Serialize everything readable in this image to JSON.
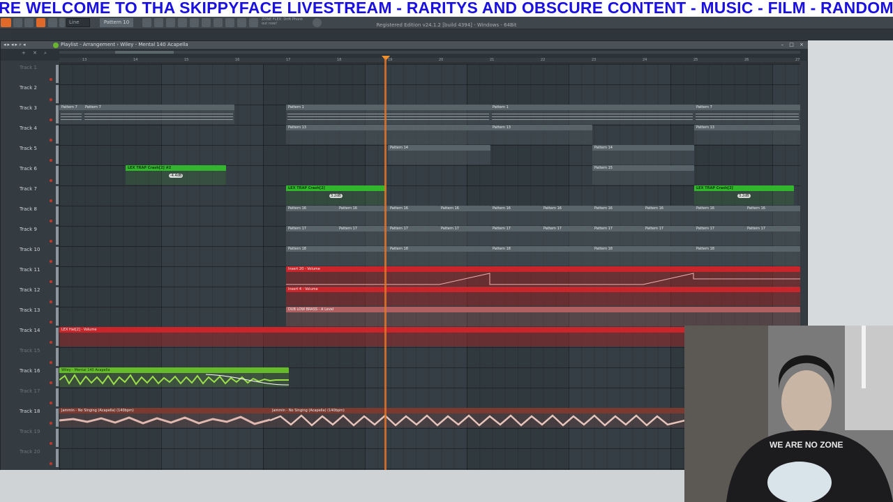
{
  "banner": {
    "text": "RE  WELCOME TO THA SKIPPYFACE LIVESTREAM  - RARITYS AND OBSCURE CONTENT - MUSIC - FILM - RANDOM - GTARP / C"
  },
  "toolbar": {
    "snap": "Line",
    "pattern": "Pattern 10",
    "hint_line1": "ZONE FLEX: Drift Phonk",
    "hint_line2": "out now!"
  },
  "playlist": {
    "title": "Playlist - Arrangement › Wiley - Mental 140 Acapella",
    "controls": "– □ ×"
  },
  "ruler": [
    "13",
    "14",
    "15",
    "16",
    "17",
    "18",
    "19",
    "20",
    "21",
    "22",
    "23",
    "24",
    "25",
    "26",
    "27"
  ],
  "tracks": [
    {
      "label": "Track 1",
      "dim": true
    },
    {
      "label": "Track 2",
      "dim": false
    },
    {
      "label": "Track 3",
      "dim": false
    },
    {
      "label": "Track 4",
      "dim": false
    },
    {
      "label": "Track 5",
      "dim": false
    },
    {
      "label": "Track 6",
      "dim": false
    },
    {
      "label": "Track 7",
      "dim": false
    },
    {
      "label": "Track 8",
      "dim": false
    },
    {
      "label": "Track 9",
      "dim": false
    },
    {
      "label": "Track 10",
      "dim": false
    },
    {
      "label": "Track 11",
      "dim": false
    },
    {
      "label": "Track 12",
      "dim": false
    },
    {
      "label": "Track 13",
      "dim": false
    },
    {
      "label": "Track 14",
      "dim": false
    },
    {
      "label": "Track 15",
      "dim": true
    },
    {
      "label": "Track 16",
      "dim": false
    },
    {
      "label": "Track 17",
      "dim": true
    },
    {
      "label": "Track 18",
      "dim": false
    },
    {
      "label": "Track 19",
      "dim": true
    },
    {
      "label": "Track 20",
      "dim": true
    }
  ],
  "clips": {
    "pattern7": "Pattern 7",
    "pattern1": "Pattern 1",
    "pattern13": "Pattern 13",
    "pattern14": "Pattern 14",
    "pattern15": "Pattern 15",
    "pattern16": "Pattern 16",
    "pattern17": "Pattern 17",
    "pattern18": "Pattern 18",
    "trap_crash_2": "LEX TRAP Crash[2] #2",
    "trap_crash": "LEX TRAP Crash[2]",
    "insert20": "Insert 20 - Volume",
    "insert4": "Insert 4 - Volume",
    "sub_brass": "DUB LOW BRASS - A Level",
    "hat_vol": "LEX Hat[2] - Volume",
    "wiley": "Wiley - Mental 140 Acapella",
    "jammin": "Jammin - No Singing (Acapella) (140bpm)",
    "vol_a": "-4.4dB",
    "vol_b": "3.2dB",
    "vol_c": "3.2dB"
  },
  "status": "Registered Edition  v24.1.2 [build 4394] - Windows - 64Bit",
  "colors": {
    "accent": "#e0742a",
    "banner_text": "#1a10e0",
    "green_clip": "#33b52e",
    "red_clip": "#c8262a"
  }
}
